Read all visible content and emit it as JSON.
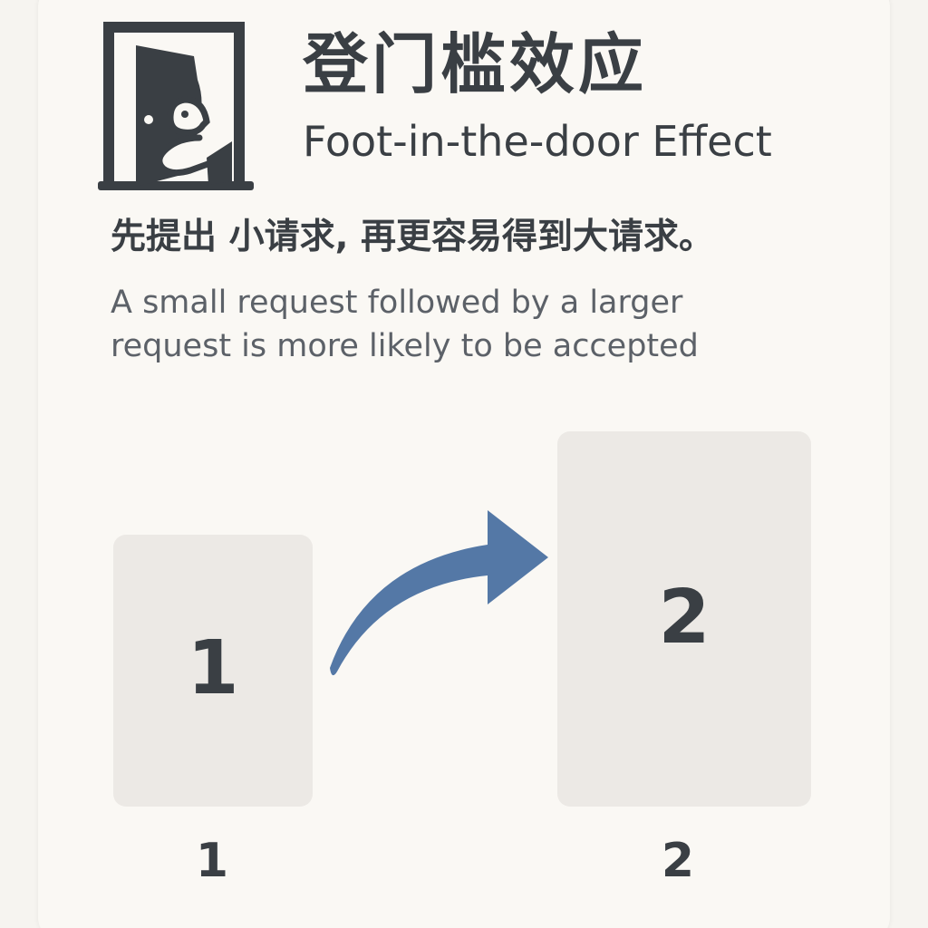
{
  "header": {
    "title_zh": "登门槛效应",
    "title_en": "Foot-in-the-door Effect",
    "icon": "door-foot-icon"
  },
  "description": {
    "zh": "先提出 小请求, 再更容易得到大请求。",
    "en": "A small request followed by a larger request is more likely to be accepted"
  },
  "diagram": {
    "small_box_label": "1",
    "large_box_label": "2",
    "small_caption": "1",
    "large_caption": "2",
    "arrow_icon": "curved-arrow-right-icon"
  },
  "colors": {
    "background": "#faf8f4",
    "text": "#3a3f44",
    "box": "#ece9e5",
    "arrow": "#5478a6"
  }
}
